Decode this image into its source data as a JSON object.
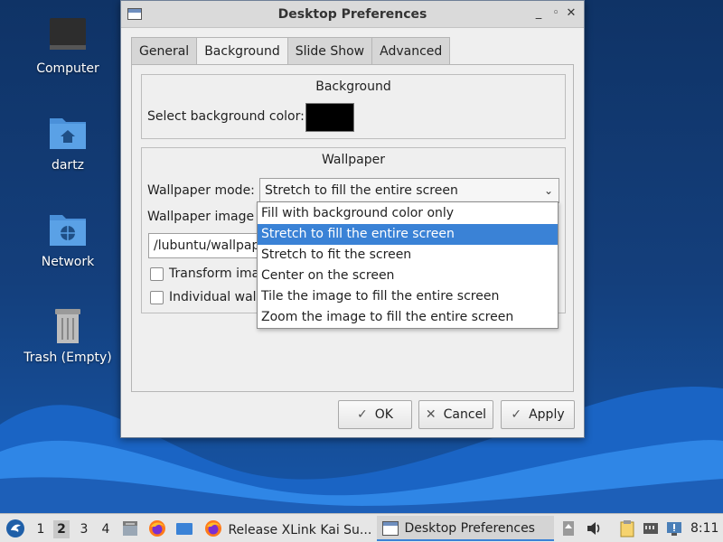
{
  "desktop": {
    "icons": [
      {
        "label": "Computer",
        "icon": "computer-icon"
      },
      {
        "label": "dartz",
        "icon": "home-folder-icon"
      },
      {
        "label": "Network",
        "icon": "network-folder-icon"
      },
      {
        "label": "Trash (Empty)",
        "icon": "trash-icon"
      }
    ]
  },
  "window": {
    "title": "Desktop Preferences",
    "controls": {
      "minimize": "_",
      "maximize": "◦",
      "close": "✕"
    },
    "tabs": [
      {
        "label": "General"
      },
      {
        "label": "Background"
      },
      {
        "label": "Slide Show"
      },
      {
        "label": "Advanced"
      }
    ],
    "background_group": {
      "title": "Background",
      "color_label": "Select background color:",
      "color_value": "#000000"
    },
    "wallpaper_group": {
      "title": "Wallpaper",
      "mode_label": "Wallpaper mode:",
      "mode_value": "Stretch to fill the entire screen",
      "image_label": "Wallpaper image f",
      "image_path": "/lubuntu/wallpap",
      "transform_label": "Transform ima",
      "individual_label": "Individual wall"
    },
    "dropdown_options": [
      "Fill with background color only",
      "Stretch to fill the entire screen",
      "Stretch to fit the screen",
      "Center on the screen",
      "Tile the image to fill the entire screen",
      "Zoom the image to fill the entire screen"
    ],
    "buttons": {
      "ok": "OK",
      "cancel": "Cancel",
      "apply": "Apply"
    }
  },
  "taskbar": {
    "workspaces": [
      "1",
      "2",
      "3",
      "4"
    ],
    "active_workspace": "2",
    "tasks": [
      {
        "label": "Release XLink Kai Su...",
        "icon": "firefox-icon"
      },
      {
        "label": "Desktop Preferences",
        "icon": "window-icon"
      }
    ],
    "clock": "8:11"
  },
  "colors": {
    "accent": "#3a82d6",
    "wallpaper": "#143f7c"
  }
}
